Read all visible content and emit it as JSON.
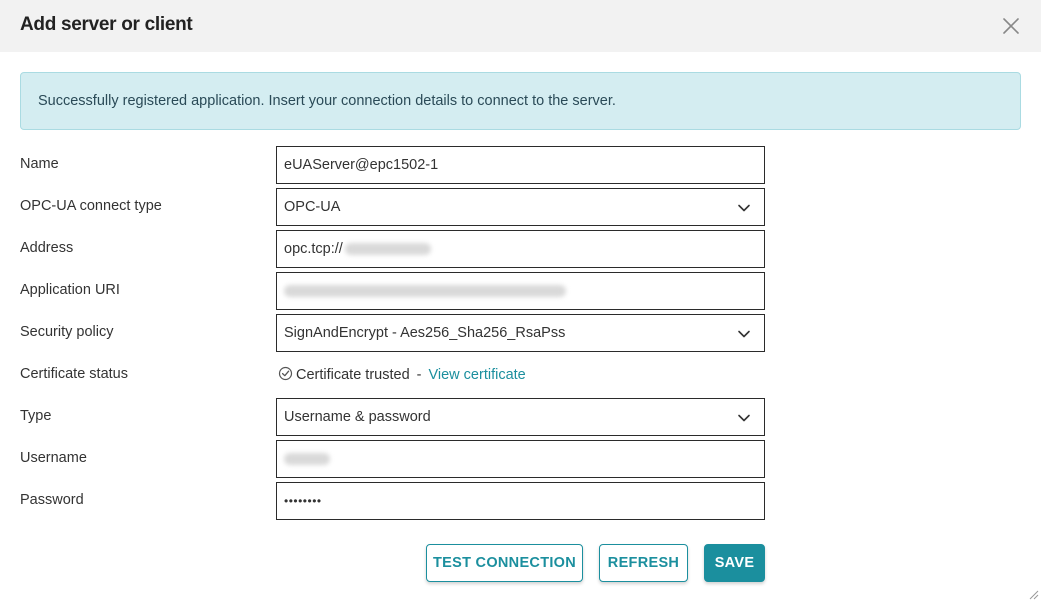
{
  "dialog": {
    "title": "Add server or client",
    "close_icon": "close-icon"
  },
  "alert": {
    "message": "Successfully registered application. Insert your connection details to connect to the server."
  },
  "form": {
    "name": {
      "label": "Name",
      "value": "eUAServer@epc1502-1"
    },
    "connect_type": {
      "label": "OPC-UA connect type",
      "value": "OPC-UA"
    },
    "address": {
      "label": "Address",
      "value": "opc.tcp://"
    },
    "application_uri": {
      "label": "Application URI",
      "value": ""
    },
    "security_policy": {
      "label": "Security policy",
      "value": "SignAndEncrypt - Aes256_Sha256_RsaPss"
    },
    "certificate_status": {
      "label": "Certificate status",
      "value": "Certificate trusted",
      "separator": "-",
      "link": "View certificate"
    },
    "type": {
      "label": "Type",
      "value": "Username & password"
    },
    "username": {
      "label": "Username",
      "value": ""
    },
    "password": {
      "label": "Password",
      "value": "••••••••"
    }
  },
  "buttons": {
    "test_connection": "TEST CONNECTION",
    "refresh": "REFRESH",
    "save": "SAVE"
  },
  "colors": {
    "accent": "#1b8f9e",
    "alert_bg": "#d4edf1",
    "header_bg": "#f2f2f2"
  }
}
